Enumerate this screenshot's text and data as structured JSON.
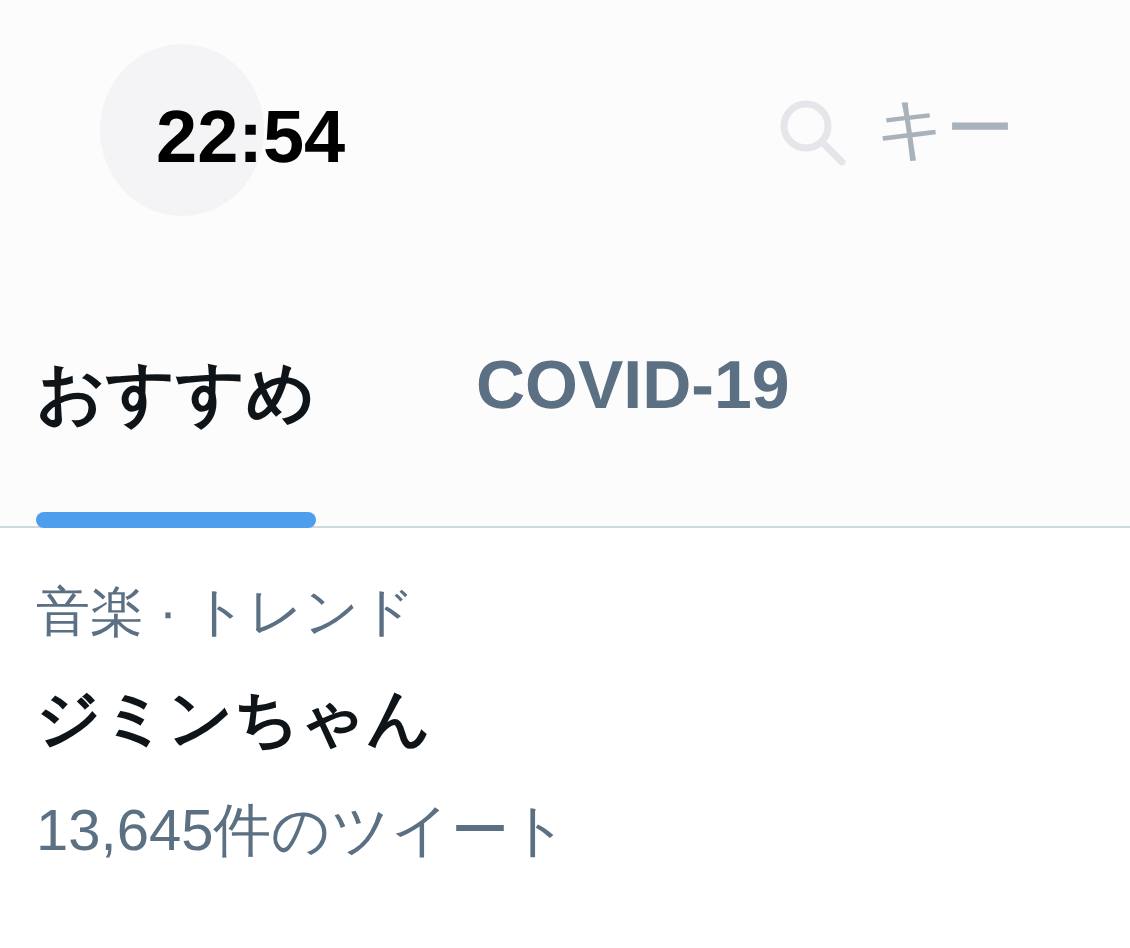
{
  "status_bar": {
    "time": "22:54"
  },
  "search": {
    "placeholder": "キー"
  },
  "tabs": [
    {
      "label": "おすすめ",
      "selected": true
    },
    {
      "label": "COVID-19",
      "selected": false
    }
  ],
  "trend": {
    "context": "音楽 · トレンド",
    "title": "ジミンちゃん",
    "count": "13,645件のツイート"
  }
}
